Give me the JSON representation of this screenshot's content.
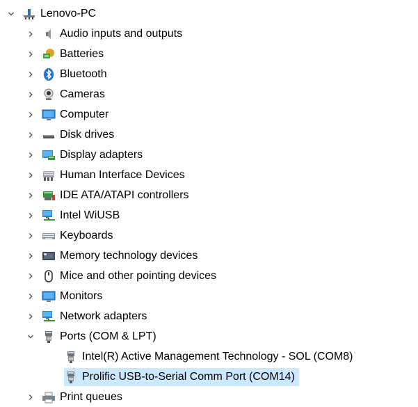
{
  "root": {
    "label": "Lenovo-PC",
    "icon": "computer-tree-icon",
    "expanded": true
  },
  "categories": [
    {
      "label": "Audio inputs and outputs",
      "icon": "speaker-icon"
    },
    {
      "label": "Batteries",
      "icon": "battery-icon"
    },
    {
      "label": "Bluetooth",
      "icon": "bluetooth-icon"
    },
    {
      "label": "Cameras",
      "icon": "camera-icon"
    },
    {
      "label": "Computer",
      "icon": "monitor-icon"
    },
    {
      "label": "Disk drives",
      "icon": "disk-drive-icon"
    },
    {
      "label": "Display adapters",
      "icon": "display-adapter-icon"
    },
    {
      "label": "Human Interface Devices",
      "icon": "hid-icon"
    },
    {
      "label": "IDE ATA/ATAPI controllers",
      "icon": "ide-controller-icon"
    },
    {
      "label": "Intel WiUSB",
      "icon": "network-icon"
    },
    {
      "label": "Keyboards",
      "icon": "keyboard-icon"
    },
    {
      "label": "Memory technology devices",
      "icon": "memory-device-icon"
    },
    {
      "label": "Mice and other pointing devices",
      "icon": "mouse-icon"
    },
    {
      "label": "Monitors",
      "icon": "monitor-icon"
    },
    {
      "label": "Network adapters",
      "icon": "network-icon"
    },
    {
      "label": "Ports (COM & LPT)",
      "icon": "port-icon",
      "expanded": true,
      "children": [
        {
          "label": "Intel(R) Active Management Technology - SOL (COM8)",
          "icon": "port-icon"
        },
        {
          "label": "Prolific USB-to-Serial Comm Port (COM14)",
          "icon": "port-icon",
          "selected": true
        }
      ]
    },
    {
      "label": "Print queues",
      "icon": "printer-icon"
    }
  ],
  "colors": {
    "selection": "#cce8ff",
    "chevron": "#555555",
    "icon_blue": "#1e88e5"
  }
}
